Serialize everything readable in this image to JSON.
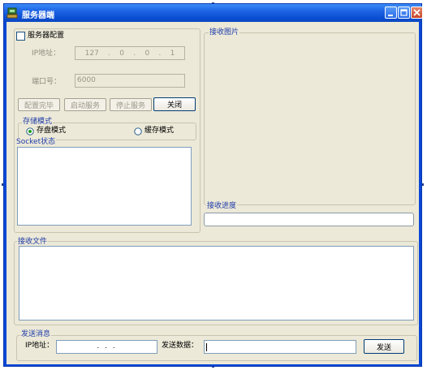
{
  "window": {
    "title": "服务器端"
  },
  "server_config": {
    "checkbox_label": "服务器配置",
    "ip_label": "IP地址：",
    "ip_parts": [
      "127",
      "0",
      "0",
      "1"
    ],
    "port_label": "端口号：",
    "port_value": "6000",
    "buttons": {
      "config_done": "配置完毕",
      "start": "启动服务",
      "stop": "停止服务",
      "close": "关闭"
    }
  },
  "storage_mode": {
    "title": "存储模式",
    "option_disk": "存盘模式",
    "option_cache": "缓存模式",
    "selected": "存盘模式"
  },
  "socket_status": {
    "title": "Socket状态"
  },
  "received_image": {
    "title": "接收图片"
  },
  "receive_progress": {
    "title": "接收进度",
    "value": 0
  },
  "received_files": {
    "title": "接收文件"
  },
  "send_message": {
    "title": "发送消息",
    "ip_label": "IP地址：",
    "ip_separators": ". . .",
    "data_label": "发送数据：",
    "send_button": "发送"
  }
}
